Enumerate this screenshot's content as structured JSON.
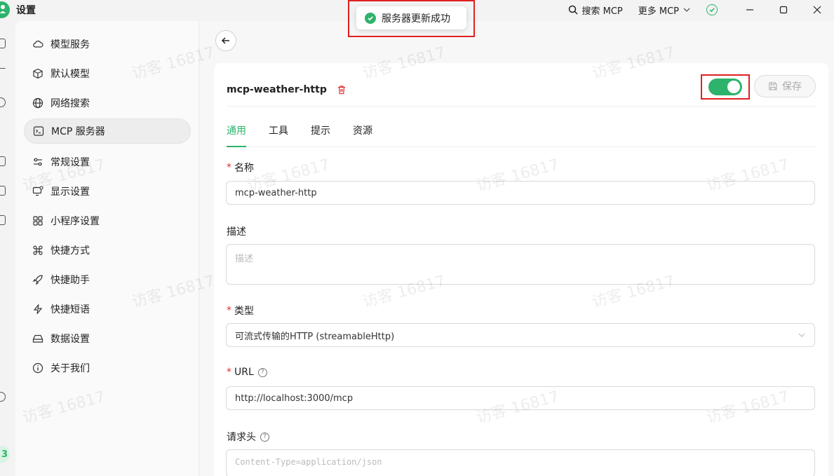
{
  "app": {
    "title": "设置"
  },
  "top": {
    "search_label": "搜索 MCP",
    "more_label": "更多 MCP"
  },
  "toast": {
    "message": "服务器更新成功"
  },
  "watermark": "访客 16817",
  "nav": {
    "items": [
      {
        "label": "模型服务",
        "icon": "cloud-icon"
      },
      {
        "label": "默认模型",
        "icon": "cube-icon"
      },
      {
        "label": "网络搜索",
        "icon": "globe-icon"
      },
      {
        "label": "MCP 服务器",
        "icon": "terminal-icon",
        "active": true
      },
      {
        "label": "常规设置",
        "icon": "sliders-icon"
      },
      {
        "label": "显示设置",
        "icon": "monitor-icon"
      },
      {
        "label": "小程序设置",
        "icon": "grid-icon"
      },
      {
        "label": "快捷方式",
        "icon": "command-icon"
      },
      {
        "label": "快捷助手",
        "icon": "rocket-icon"
      },
      {
        "label": "快捷短语",
        "icon": "zap-icon"
      },
      {
        "label": "数据设置",
        "icon": "hard-drive-icon"
      },
      {
        "label": "关于我们",
        "icon": "info-icon"
      }
    ]
  },
  "rail": {
    "badge": "3"
  },
  "server": {
    "name": "mcp-weather-http",
    "enabled": true,
    "save_label": "保存",
    "tabs": [
      "通用",
      "工具",
      "提示",
      "资源"
    ],
    "active_tab": 0
  },
  "form": {
    "name_label": "名称",
    "name_value": "mcp-weather-http",
    "desc_label": "描述",
    "desc_placeholder": "描述",
    "type_label": "类型",
    "type_value": "可流式传输的HTTP (streamableHttp)",
    "url_label": "URL",
    "url_value": "http://localhost:3000/mcp",
    "headers_label": "请求头",
    "headers_placeholder": "Content-Type=application/json"
  },
  "colors": {
    "accent": "#2db36b",
    "highlight": "#e02020"
  }
}
